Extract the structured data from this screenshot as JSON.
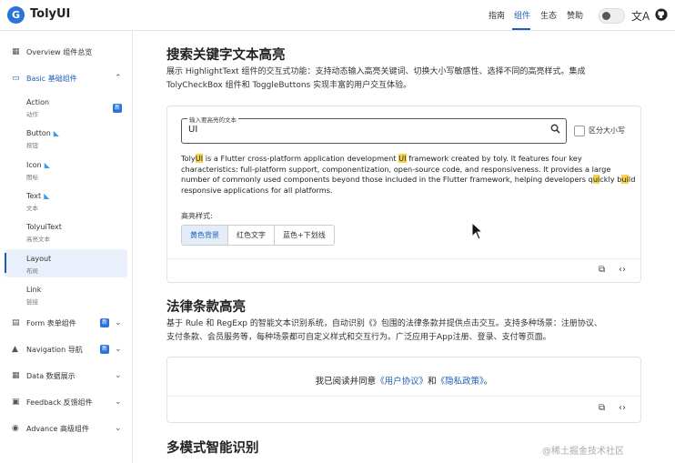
{
  "header": {
    "brand": "TolyUI",
    "logo_letter": "G",
    "nav": [
      "指南",
      "组件",
      "生态",
      "赞助"
    ],
    "active_nav": "组件",
    "translate_icon": "文A",
    "github_icon": "github-icon"
  },
  "sidebar": {
    "overview": "Overview 组件总览",
    "basic": "Basic 基础组件",
    "basic_items": [
      {
        "label": "Action",
        "caption": "动作"
      },
      {
        "label": "Button",
        "caption": "按钮"
      },
      {
        "label": "Icon",
        "caption": "图标"
      },
      {
        "label": "Text",
        "caption": "文本"
      },
      {
        "label": "TolyuiText",
        "caption": "高亮文本"
      },
      {
        "label": "Layout",
        "caption": "布局"
      },
      {
        "label": "Link",
        "caption": "链接"
      }
    ],
    "groups": [
      "Form 表单组件",
      "Navigation 导航",
      "Data 数据展示",
      "Feedback 反馈组件",
      "Advance 高级组件"
    ],
    "new_badge": "新"
  },
  "section1": {
    "title": "搜索关键字文本高亮",
    "desc1": "展示 HighlightText 组件的交互式功能：支持动态输入高亮关键词、切换大小写敏感性、选择不同的高亮样式。集成",
    "desc2": "TolyCheckBox 组件和 ToggleButtons 实现丰富的用户交互体验。",
    "field_label": "输入要高亮的文本",
    "field_value": "UI",
    "case_label": "区分大小写",
    "para": {
      "t1": "Toly",
      "h1": "UI",
      "t2": " is a Flutter cross-platform application development ",
      "h2": "UI",
      "t3": " framework created by toly. It features four key characteristics: full-platform support, componentization, open-source code, and responsiveness. It provides a large number of commonly used components beyond those included in the Flutter framework, helping developers q",
      "h3": "ui",
      "t4": "ckly b",
      "h4": "ui",
      "t5": "ld responsive applications for all platforms."
    },
    "style_label": "高亮样式:",
    "styles": [
      "黄色背景",
      "红色文字",
      "蓝色+下划线"
    ]
  },
  "section2": {
    "title": "法律条款高亮",
    "desc1": "基于 Rule 和 RegExp 的智能文本识别系统，自动识别《》包围的法律条款并提供点击交互。支持多种场景：注册协议、",
    "desc2": "支付条款、会员服务等，每种场景都可自定义样式和交互行为。广泛应用于App注册、登录、支付等页面。",
    "legal_prefix": "我已阅读并同意",
    "link1": "《用户协议》",
    "and": "和",
    "link2": "《隐私政策》",
    "suffix": "。"
  },
  "section3": {
    "title": "多模式智能识别"
  },
  "watermark": "@稀土掘金技术社区",
  "colors": {
    "accent": "#1d5fb8",
    "highlight": "#f7d34a"
  }
}
